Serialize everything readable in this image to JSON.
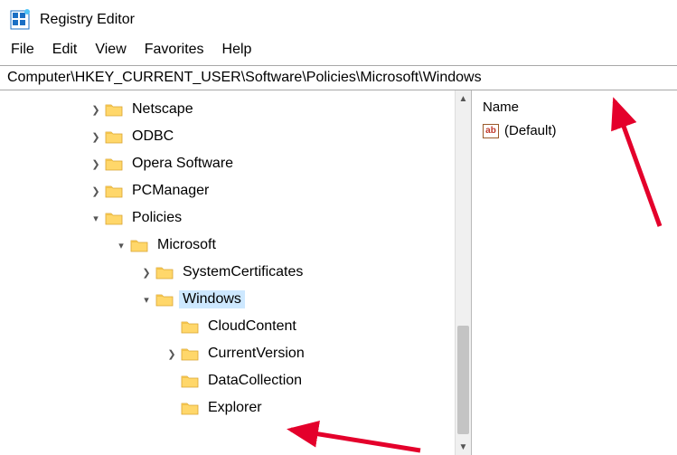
{
  "app": {
    "title": "Registry Editor"
  },
  "menubar": {
    "items": [
      "File",
      "Edit",
      "View",
      "Favorites",
      "Help"
    ]
  },
  "addressbar": {
    "path": "Computer\\HKEY_CURRENT_USER\\Software\\Policies\\Microsoft\\Windows"
  },
  "tree": {
    "nodes": [
      {
        "indent": 98,
        "expander": "right",
        "label": "Netscape"
      },
      {
        "indent": 98,
        "expander": "right",
        "label": "ODBC"
      },
      {
        "indent": 98,
        "expander": "right",
        "label": "Opera Software"
      },
      {
        "indent": 98,
        "expander": "right",
        "label": "PCManager"
      },
      {
        "indent": 98,
        "expander": "down",
        "label": "Policies"
      },
      {
        "indent": 126,
        "expander": "down",
        "label": "Microsoft"
      },
      {
        "indent": 154,
        "expander": "right",
        "label": "SystemCertificates"
      },
      {
        "indent": 154,
        "expander": "down",
        "label": "Windows",
        "selected": true
      },
      {
        "indent": 182,
        "expander": "none",
        "label": "CloudContent"
      },
      {
        "indent": 182,
        "expander": "right",
        "label": "CurrentVersion"
      },
      {
        "indent": 182,
        "expander": "none",
        "label": "DataCollection"
      },
      {
        "indent": 182,
        "expander": "none",
        "label": "Explorer"
      }
    ]
  },
  "list": {
    "header": "Name",
    "rows": [
      {
        "icon": "ab",
        "label": "(Default)"
      }
    ]
  }
}
